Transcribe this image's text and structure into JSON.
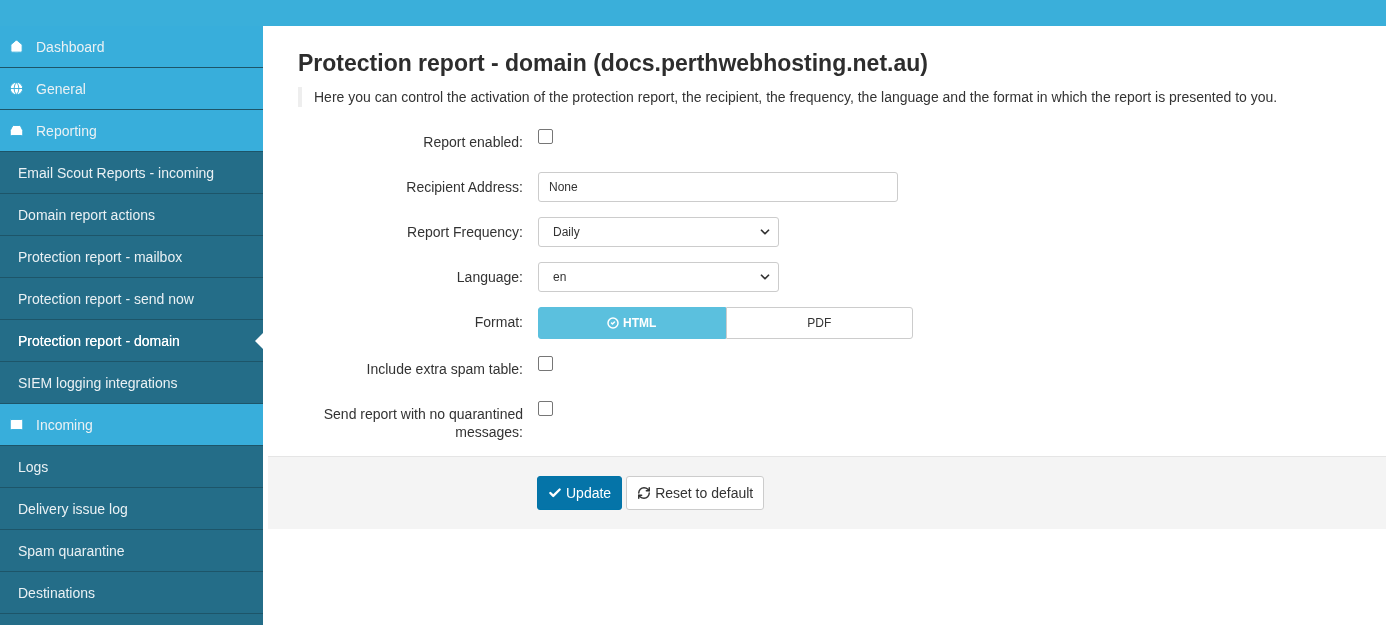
{
  "sidebar": {
    "items": [
      {
        "label": "Dashboard",
        "kind": "section",
        "selected": false
      },
      {
        "label": "General",
        "kind": "section",
        "selected": false
      },
      {
        "label": "Reporting",
        "kind": "section",
        "selected": false
      },
      {
        "label": "Email Scout Reports - incoming",
        "kind": "sub",
        "selected": false
      },
      {
        "label": "Domain report actions",
        "kind": "sub",
        "selected": false
      },
      {
        "label": "Protection report - mailbox",
        "kind": "sub",
        "selected": false
      },
      {
        "label": "Protection report - send now",
        "kind": "sub",
        "selected": false
      },
      {
        "label": "Protection report - domain",
        "kind": "sub",
        "selected": true
      },
      {
        "label": "SIEM logging integrations",
        "kind": "sub",
        "selected": false
      },
      {
        "label": "Incoming",
        "kind": "section",
        "selected": false
      },
      {
        "label": "Logs",
        "kind": "sub",
        "selected": false
      },
      {
        "label": "Delivery issue log",
        "kind": "sub",
        "selected": false
      },
      {
        "label": "Spam quarantine",
        "kind": "sub",
        "selected": false
      },
      {
        "label": "Destinations",
        "kind": "sub",
        "selected": false
      }
    ]
  },
  "page": {
    "title": "Protection report - domain (docs.perthwebhosting.net.au)",
    "description": "Here you can control the activation of the protection report, the recipient, the frequency, the language and the format in which the report is presented to you."
  },
  "form": {
    "fields": [
      {
        "kind": "checkbox",
        "label": "Report enabled:",
        "checked": false
      },
      {
        "kind": "text",
        "label": "Recipient Address:",
        "value": "None"
      },
      {
        "kind": "select",
        "label": "Report Frequency:",
        "value": "Daily"
      },
      {
        "kind": "select",
        "label": "Language:",
        "value": "en"
      },
      {
        "kind": "toggle",
        "label": "Format:",
        "options": [
          {
            "label": "HTML",
            "selected": true
          },
          {
            "label": "PDF",
            "selected": false
          }
        ]
      },
      {
        "kind": "checkbox",
        "label": "Include extra spam table:",
        "checked": false
      },
      {
        "kind": "checkbox",
        "label": "Send report with no quarantined messages:",
        "checked": false
      }
    ]
  },
  "buttons": [
    {
      "label": "Update",
      "kind": "primary"
    },
    {
      "label": "Reset to default",
      "kind": "reset"
    }
  ]
}
